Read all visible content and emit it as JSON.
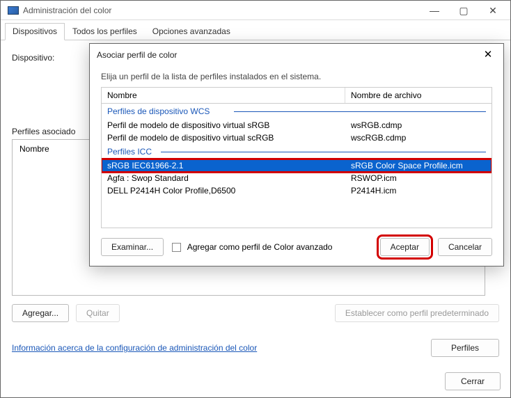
{
  "main": {
    "title": "Administración del color",
    "tabs": [
      "Dispositivos",
      "Todos los perfiles",
      "Opciones avanzadas"
    ],
    "device_label": "Dispositivo:",
    "assoc_label": "Perfiles asociado",
    "table_col": "Nombre",
    "add": "Agregar...",
    "remove": "Quitar",
    "set_default": "Establecer como perfil predeterminado",
    "info_link": "Información acerca de la configuración de administración del color",
    "profiles_btn": "Perfiles",
    "close": "Cerrar"
  },
  "dialog": {
    "title": "Asociar perfil de color",
    "instruction": "Elija un perfil de la lista de perfiles instalados en el sistema.",
    "col_name": "Nombre",
    "col_file": "Nombre de archivo",
    "group_wcs": "Perfiles de dispositivo WCS",
    "group_icc": "Perfiles ICC",
    "rows_wcs": [
      {
        "name": "Perfil de modelo de dispositivo virtual sRGB",
        "file": "wsRGB.cdmp"
      },
      {
        "name": "Perfil de modelo de dispositivo virtual scRGB",
        "file": "wscRGB.cdmp"
      }
    ],
    "rows_icc": [
      {
        "name": "sRGB IEC61966-2.1",
        "file": "sRGB Color Space Profile.icm"
      },
      {
        "name": "Agfa : Swop Standard",
        "file": "RSWOP.icm"
      },
      {
        "name": "DELL P2414H Color Profile,D6500",
        "file": "P2414H.icm"
      }
    ],
    "browse": "Examinar...",
    "advanced_cb": "Agregar como perfil de Color avanzado",
    "ok": "Aceptar",
    "cancel": "Cancelar"
  }
}
